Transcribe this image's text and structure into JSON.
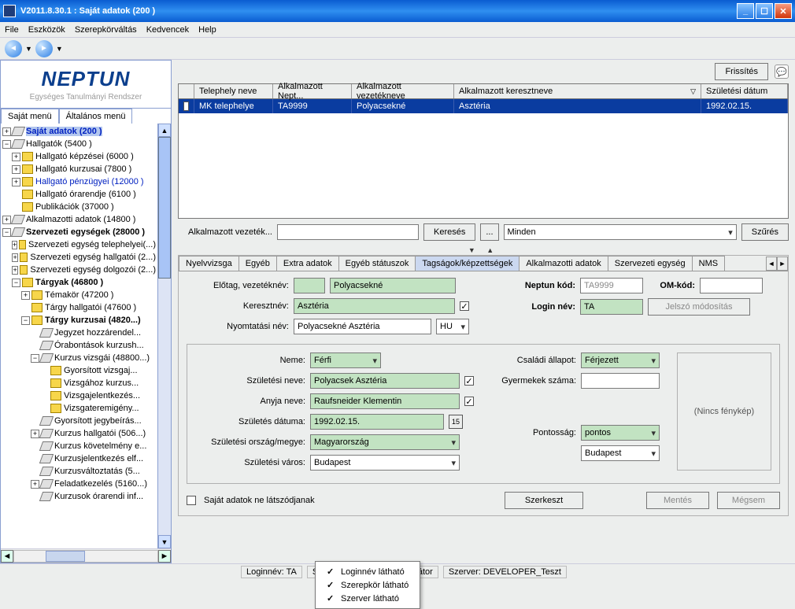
{
  "window": {
    "title": "V2011.8.30.1 : Saját adatok (200  )"
  },
  "menu": {
    "file": "File",
    "tools": "Eszközök",
    "role": "Szerepkörváltás",
    "fav": "Kedvencek",
    "help": "Help"
  },
  "sidebar": {
    "brand": "NEPTUN",
    "subtitle": "Egységes Tanulmányi Rendszer",
    "tabs": {
      "own": "Saját menü",
      "gen": "Általános menü"
    },
    "nodes": {
      "n0": "Saját adatok (200  )",
      "n1": "Hallgatók (5400  )",
      "n1a": "Hallgató képzései (6000  )",
      "n1b": "Hallgató kurzusai (7800  )",
      "n1c": "Hallgató pénzügyei (12000  )",
      "n1d": "Hallgató órarendje (6100  )",
      "n1e": "Publikációk (37000  )",
      "n2": "Alkalmazotti adatok (14800  )",
      "n3": "Szervezeti egységek (28000  )",
      "n3a": "Szervezeti egység telephelyei(...)",
      "n3b": "Szervezeti egység hallgatói (2...)",
      "n3c": "Szervezeti egység dolgozói (2...)",
      "n4": "Tárgyak (46800  )",
      "n4a": "Témakör (47200  )",
      "n4b": "Tárgy hallgatói (47600  )",
      "n4c": "Tárgy kurzusai (4820...)",
      "n4c1": "Jegyzet hozzárendel...",
      "n4c2": "Órabontások kurzush...",
      "n4c3": "Kurzus vizsgái (48800...)",
      "n4c3a": "Gyorsított vizsgaj...",
      "n4c3b": "Vizsgához kurzus...",
      "n4c3c": "Vizsgajelentkezés...",
      "n4c3d": "Vizsgateremigény...",
      "n4c4": "Gyorsított jegybeírás...",
      "n4c5": "Kurzus hallgatói (506...)",
      "n4c6": "Kurzus követelmény e...",
      "n4c7": "Kurzusjelentkezés elf...",
      "n4c8": "Kurzusváltoztatás (5...",
      "n4c9": "Feladatkezelés (5160...)",
      "n4c10": "Kurzusok órarendi inf..."
    }
  },
  "toolbar_top": {
    "refresh": "Frissítés"
  },
  "grid": {
    "cols": {
      "c0": "",
      "c1": "Telephely neve",
      "c2": "Alkalmazott Nept...",
      "c3": "Alkalmazott vezetékneve",
      "c4": "Alkalmazott keresztneve",
      "c5": "Születési dátum"
    },
    "r0": {
      "c1": "MK telephelye",
      "c2": "TA9999",
      "c3": "Polyacsekné",
      "c4": "Asztéria",
      "c5": "1992.02.15."
    }
  },
  "search": {
    "lbl": "Alkalmazott vezeték...",
    "btnSearch": "Keresés",
    "btnDots": "...",
    "all": "Minden",
    "btnFilter": "Szűrés"
  },
  "formtabs": {
    "t0": "Nyelvvizsga",
    "t1": "Egyéb",
    "t2": "Extra adatok",
    "t3": "Egyéb státuszok",
    "t4": "Tagságok/képzettségek",
    "t5": "Alkalmazotti adatok",
    "t6": "Szervezeti egység",
    "t7": "NMS"
  },
  "form": {
    "l_prefix": "Előtag, vezetéknév:",
    "v_lastname": "Polyacsekné",
    "l_first": "Keresztnév:",
    "v_first": "Asztéria",
    "l_print": "Nyomtatási név:",
    "v_print": "Polyacsekné Asztéria",
    "lang": "HU",
    "l_neptun": "Neptun kód:",
    "v_neptun": "TA9999",
    "l_om": "OM-kód:",
    "l_login": "Login név:",
    "v_login": "TA",
    "btn_pw": "Jelszó módosítás",
    "l_sex": "Neme:",
    "v_sex": "Férfi",
    "l_birthname": "Születési neve:",
    "v_birthname": "Polyacsek Asztéria",
    "l_mother": "Anyja neve:",
    "v_mother": "Raufsneider Klementin",
    "l_bdate": "Születés dátuma:",
    "v_bdate": "1992.02.15.",
    "l_bcountry": "Születési ország/megye:",
    "v_bcountry": "Magyarország",
    "v_bcounty": "Budapest",
    "l_bcity": "Születési város:",
    "v_bcity": "Budapest",
    "l_family": "Családi állapot:",
    "v_family": "Férjezett",
    "l_children": "Gyermekek száma:",
    "l_accuracy": "Pontosság:",
    "v_accuracy": "pontos",
    "nophoto": "(Nincs fénykép)",
    "chk_hide": "Saját adatok ne látszódjanak",
    "btn_edit": "Szerkeszt",
    "btn_save": "Mentés",
    "btn_cancel": "Mégsem"
  },
  "status": {
    "p1": "Loginnév: TA",
    "p2hidden": "S",
    "p3hidden": "trátor",
    "p4": "Szerver: DEVELOPER_Teszt"
  },
  "popup": {
    "i1": "Loginnév látható",
    "i2": "Szerepkör látható",
    "i3": "Szerver látható"
  }
}
